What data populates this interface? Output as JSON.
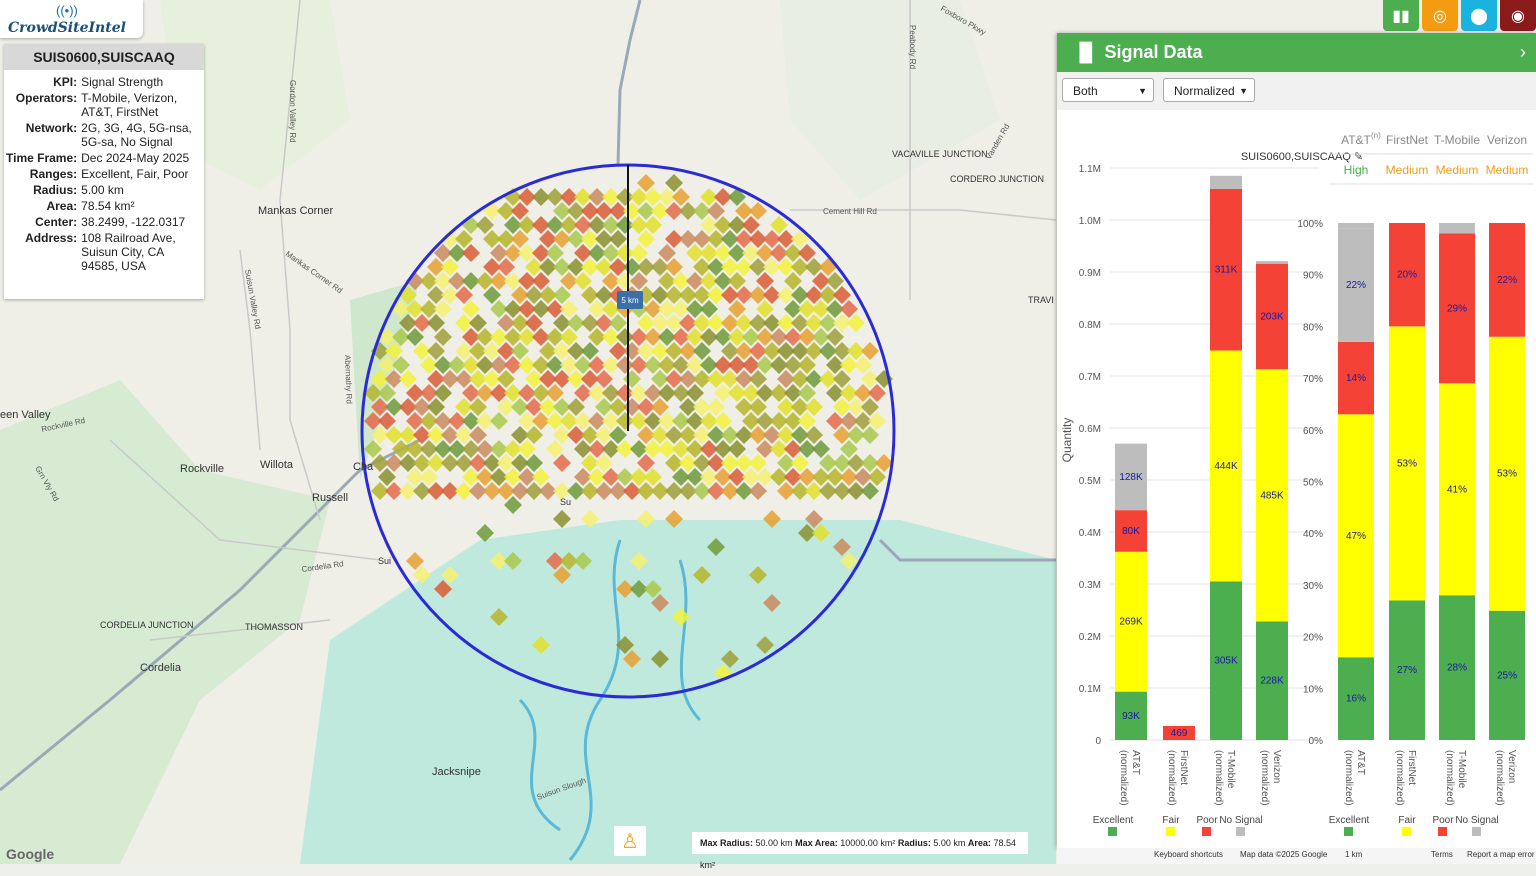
{
  "app": {
    "logo_text": "CrowdSiteIntel"
  },
  "info": {
    "site_id": "SUIS0600,SUISCAAQ",
    "rows": [
      {
        "key": "KPI:",
        "value": "Signal Strength"
      },
      {
        "key": "Operators:",
        "value": "T-Mobile, Verizon, AT&T, FirstNet"
      },
      {
        "key": "Network:",
        "value": "2G, 3G, 4G, 5G-nsa, 5G-sa, No Signal"
      },
      {
        "key": "Time Frame:",
        "value": "Dec 2024-May 2025"
      },
      {
        "key": "Ranges:",
        "value": "Excellent, Fair, Poor"
      },
      {
        "key": "Radius:",
        "value": "5.00 km"
      },
      {
        "key": "Area:",
        "value": "78.54 km²"
      },
      {
        "key": "Center:",
        "value": "38.2499, -122.0317"
      },
      {
        "key": "Address:",
        "value": "108 Railroad Ave, Suisun City, CA 94585, USA"
      }
    ]
  },
  "toolbar": {
    "buttons": [
      {
        "icon": "bar-chart-icon",
        "color": "#4cae4f"
      },
      {
        "icon": "target-icon",
        "color": "#f39c12"
      },
      {
        "icon": "location-pin-icon",
        "color": "#1ab3e0"
      },
      {
        "icon": "globe-pin-icon",
        "color": "#8b1a1a"
      }
    ]
  },
  "map": {
    "places": [
      "Mankas Corner",
      "Rockville",
      "Willota",
      "Russell",
      "Cordelia",
      "CORDELIA JUNCTION",
      "THOMASSON",
      "Jacksnipe",
      "een Valley",
      "VACAVILLE JUNCTION",
      "CORDERO JUNCTION",
      "TRAVI",
      "Sui",
      "Cha",
      "Su"
    ],
    "roads": [
      "Gordon Valley Rd",
      "Mankas Corner Rd",
      "Suisun Valley Rd",
      "Abernathy Rd",
      "Rockville Rd",
      "Cordelia Rd",
      "Cement Hill Rd",
      "Peabody Rd",
      "Foxboro Pkwy",
      "Vanden Rd",
      "Grn Vly Rd",
      "Suisun Slough"
    ],
    "radius_label": "5 km",
    "max_radius_label": "Max Radius:",
    "max_radius": "50.00 km",
    "max_area_label": "Max Area:",
    "max_area": "10000.00 km²",
    "radius_label2": "Radius:",
    "radius": "5.00 km",
    "area_label": "Area:",
    "area": "78.54 km²",
    "google": "Google",
    "footer": [
      "Keyboard shortcuts",
      "Map data ©2025 Google",
      "1 km",
      "Terms",
      "Report a map error"
    ]
  },
  "panel": {
    "title": "Signal Data",
    "select_mode": "Both",
    "select_norm": "Normalized"
  },
  "chart_data": [
    {
      "type": "bar",
      "title": "SUIS0600,SUISCAAQ",
      "ylabel": "Quantity",
      "ylim": [
        0,
        1100000
      ],
      "yticks": [
        "0",
        "0.1M",
        "0.2M",
        "0.3M",
        "0.4M",
        "0.5M",
        "0.6M",
        "0.7M",
        "0.8M",
        "0.9M",
        "1.0M",
        "1.1M"
      ],
      "categories": [
        "AT&T (normalized)",
        "FirstNet (normalized)",
        "T-Mobile (normalized)",
        "Verizon (normalized)"
      ],
      "series": [
        {
          "name": "Excellent",
          "color": "#4cae4f",
          "values": [
            93000,
            0,
            305000,
            228000
          ],
          "labels": [
            "93K",
            "",
            "305K",
            "228K"
          ]
        },
        {
          "name": "Fair",
          "color": "#ffff00",
          "values": [
            269000,
            0,
            444000,
            485000
          ],
          "labels": [
            "269K",
            "",
            "444K",
            "485K"
          ]
        },
        {
          "name": "Poor",
          "color": "#f44336",
          "values": [
            80000,
            469,
            311000,
            203000
          ],
          "labels": [
            "80K",
            "469",
            "311K",
            "203K"
          ]
        },
        {
          "name": "No Signal",
          "color": "#bdbdbd",
          "values": [
            128000,
            0,
            25000,
            5000
          ],
          "labels": [
            "128K",
            "",
            "",
            ""
          ]
        }
      ]
    },
    {
      "type": "bar",
      "ylim": [
        0,
        100
      ],
      "yticks": [
        "0%",
        "10%",
        "20%",
        "30%",
        "40%",
        "50%",
        "60%",
        "70%",
        "80%",
        "90%",
        "100%"
      ],
      "columns": [
        "AT&T",
        "FirstNet",
        "T-Mobile",
        "Verizon"
      ],
      "column_sup": [
        "(n)",
        "",
        "",
        ""
      ],
      "confidence": [
        "High",
        "Medium",
        "Medium",
        "Medium"
      ],
      "categories": [
        "AT&T (normalized)",
        "FirstNet (normalized)",
        "T-Mobile (normalized)",
        "Verizon (normalized)"
      ],
      "series": [
        {
          "name": "Excellent",
          "color": "#4cae4f",
          "values": [
            16,
            27,
            28,
            25
          ],
          "labels": [
            "16%",
            "27%",
            "28%",
            "25%"
          ]
        },
        {
          "name": "Fair",
          "color": "#ffff00",
          "values": [
            47,
            53,
            41,
            53
          ],
          "labels": [
            "47%",
            "53%",
            "41%",
            "53%"
          ]
        },
        {
          "name": "Poor",
          "color": "#f44336",
          "values": [
            14,
            20,
            29,
            22
          ],
          "labels": [
            "14%",
            "20%",
            "29%",
            "22%"
          ]
        },
        {
          "name": "No Signal",
          "color": "#bdbdbd",
          "values": [
            22,
            0,
            2,
            0
          ],
          "labels": [
            "22%",
            "",
            "",
            ""
          ]
        }
      ]
    }
  ]
}
